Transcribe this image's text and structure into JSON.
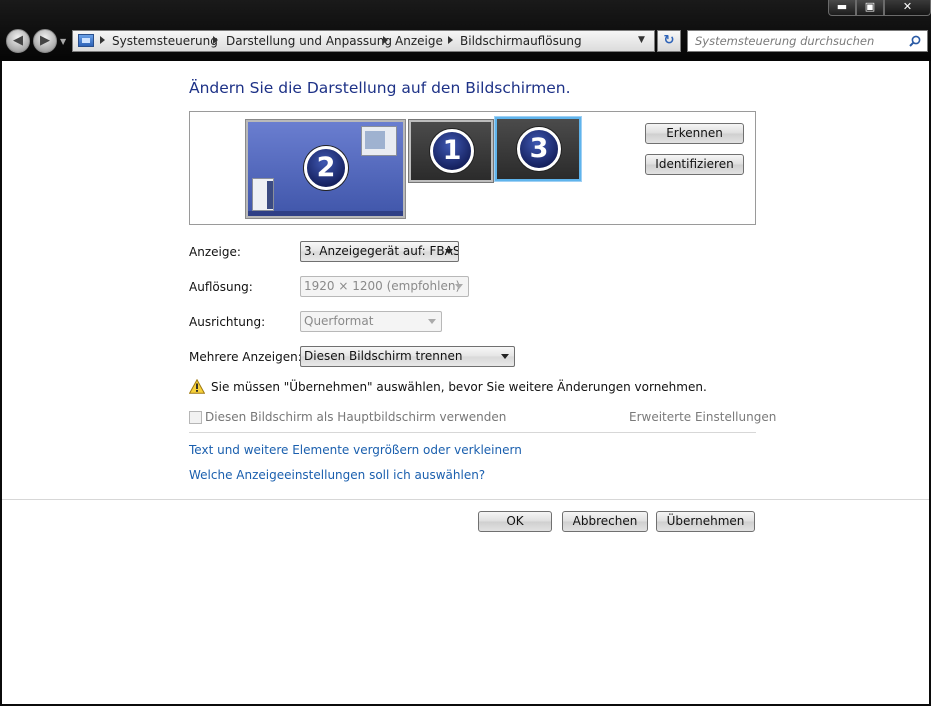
{
  "window_controls": {
    "minimize": "▬",
    "maximize": "▣",
    "close": "✕"
  },
  "nav": {
    "back_glyph": "◀",
    "forward_glyph": "▶",
    "refresh_glyph": "↻"
  },
  "breadcrumbs": [
    "Systemsteuerung",
    "Darstellung und Anpassung",
    "Anzeige",
    "Bildschirmauflösung"
  ],
  "search": {
    "placeholder": "Systemsteuerung durchsuchen"
  },
  "page": {
    "title": "Ändern Sie die Darstellung auf den Bildschirmen."
  },
  "monitors": [
    {
      "number": "2",
      "selected": false
    },
    {
      "number": "1",
      "selected": false
    },
    {
      "number": "3",
      "selected": true
    }
  ],
  "buttons": {
    "detect": "Erkennen",
    "identify": "Identifizieren",
    "ok": "OK",
    "cancel": "Abbrechen",
    "apply": "Übernehmen"
  },
  "settings": {
    "display_label": "Anzeige:",
    "display_value": "3. Anzeigegerät auf: FBAS",
    "resolution_label": "Auflösung:",
    "resolution_value": "1920 × 1200 (empfohlen)",
    "orientation_label": "Ausrichtung:",
    "orientation_value": "Querformat",
    "multiple_label": "Mehrere Anzeigen:",
    "multiple_value": "Diesen Bildschirm trennen"
  },
  "warning": "Sie müssen \"Übernehmen\" auswählen, bevor Sie weitere Änderungen vornehmen.",
  "primary_checkbox": "Diesen Bildschirm als Hauptbildschirm verwenden",
  "links": {
    "advanced": "Erweiterte Einstellungen",
    "text_size": "Text und weitere Elemente vergrößern oder verkleinern",
    "help": "Welche Anzeigeeinstellungen soll ich auswählen?"
  },
  "colors": {
    "title": "#1e3287",
    "link": "#1a5fae",
    "selected_border": "#5fb4ec"
  }
}
